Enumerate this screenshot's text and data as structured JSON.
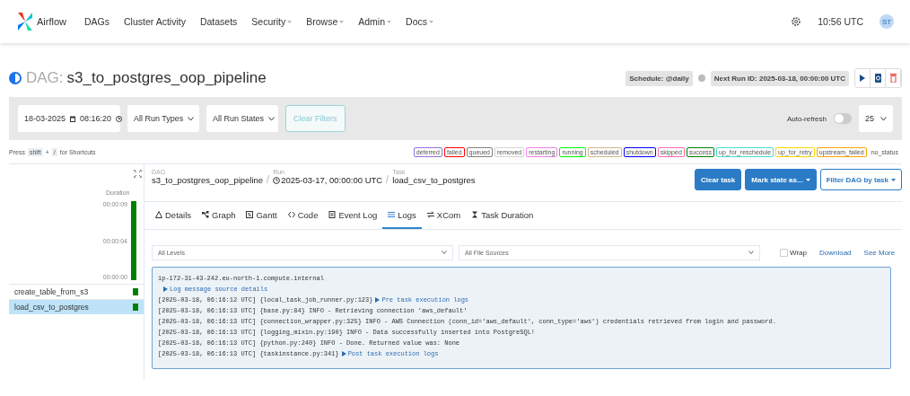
{
  "navbar": {
    "brand": "Airflow",
    "items": [
      {
        "label": "DAGs",
        "dropdown": false
      },
      {
        "label": "Cluster Activity",
        "dropdown": false
      },
      {
        "label": "Datasets",
        "dropdown": false
      },
      {
        "label": "Security",
        "dropdown": true
      },
      {
        "label": "Browse",
        "dropdown": true
      },
      {
        "label": "Admin",
        "dropdown": true
      },
      {
        "label": "Docs",
        "dropdown": true
      }
    ],
    "time": "10:56 UTC",
    "avatar": "ST"
  },
  "dag_header": {
    "paused_toggle": {
      "on": true
    },
    "prefix": "DAG:",
    "name": "s3_to_postgres_oop_pipeline",
    "schedule": "Schedule: @daily",
    "next_run": "Next Run ID: 2025-03-18, 00:00:00 UTC"
  },
  "filters": {
    "date": "18-03-2025",
    "time": "08:16:20",
    "run_types": "All Run Types",
    "run_states": "All Run States",
    "clear": "Clear Filters",
    "auto_refresh": {
      "label": "Auto-refresh",
      "on": false
    },
    "count": "25"
  },
  "shortcuts": {
    "press": "Press",
    "key1": "shift",
    "plus": "+",
    "key2": "/",
    "suffix": "for Shortcuts"
  },
  "legend": [
    {
      "label": "deferred",
      "color": "#9370db"
    },
    {
      "label": "failed",
      "color": "#ff0000"
    },
    {
      "label": "queued",
      "color": "#808080"
    },
    {
      "label": "removed",
      "color": "#d3d3d3"
    },
    {
      "label": "restarting",
      "color": "#ee82ee"
    },
    {
      "label": "running",
      "color": "#00ff00"
    },
    {
      "label": "scheduled",
      "color": "#d2b48c"
    },
    {
      "label": "shutdown",
      "color": "#0000ff"
    },
    {
      "label": "skipped",
      "color": "#ff69b4"
    },
    {
      "label": "success",
      "color": "#008000"
    },
    {
      "label": "up_for_reschedule",
      "color": "#40e0d0"
    },
    {
      "label": "up_for_retry",
      "color": "#ffd700"
    },
    {
      "label": "upstream_failed",
      "color": "#ffa500"
    },
    {
      "label": "no_status"
    }
  ],
  "grid": {
    "duration_label": "Duration",
    "ticks": [
      "00:00:09",
      "00:00:04",
      "00:00:00"
    ],
    "runs": [
      {
        "level": 1.0,
        "color": "#008000"
      }
    ],
    "tasks": [
      {
        "name": "create_table_from_s3",
        "selected": false,
        "color": "#008000"
      },
      {
        "name": "load_csv_to_postgres",
        "selected": true,
        "color": "#008000"
      }
    ]
  },
  "breadcrumb": [
    {
      "caption": "DAG",
      "value": "s3_to_postgres_oop_pipeline",
      "kind": "plain"
    },
    {
      "caption": "Run",
      "value": "2025-03-17, 00:00:00 UTC",
      "kind": "run"
    },
    {
      "caption": "Task",
      "value": "load_csv_to_postgres",
      "kind": "plain"
    }
  ],
  "actions": {
    "clear_task": "Clear task",
    "mark_state": "Mark state as...",
    "filter_dag": "Filter DAG by task"
  },
  "tabs": [
    {
      "label": "Details",
      "selected": false
    },
    {
      "label": "Graph",
      "selected": false
    },
    {
      "label": "Gantt",
      "selected": false
    },
    {
      "label": "Code",
      "selected": false
    },
    {
      "label": "Event Log",
      "selected": false
    },
    {
      "label": "Logs",
      "selected": true
    },
    {
      "label": "XCom",
      "selected": false
    },
    {
      "label": "Task Duration",
      "selected": false
    }
  ],
  "logs": {
    "level_select": "All Levels",
    "source_select": "All File Sources",
    "wrap": {
      "label": "Wrap",
      "checked": false
    },
    "download": "Download",
    "see_more": "See More",
    "lines": [
      {
        "text": "ip-172-31-43-242.eu-north-1.compute.internal"
      },
      {
        "link": "Log message source details"
      },
      {
        "text": "[2025-03-18, 06:16:12 UTC] {local_task_job_runner.py:123}",
        "link": "Pre task execution logs"
      },
      {
        "text": "[2025-03-18, 06:16:13 UTC] {base.py:84} INFO - Retrieving connection 'aws_default'"
      },
      {
        "text": "[2025-03-18, 06:16:13 UTC] {connection_wrapper.py:325} INFO - AWS Connection (conn_id='aws_default', conn_type='aws') credentials retrieved from login and password."
      },
      {
        "text": "[2025-03-18, 06:16:13 UTC] {logging_mixin.py:190} INFO - Data successfully inserted into PostgreSQL!"
      },
      {
        "text": "[2025-03-18, 06:16:13 UTC] {python.py:240} INFO - Done. Returned value was: None"
      },
      {
        "text": "[2025-03-18, 06:16:13 UTC] {taskinstance.py:341}",
        "link": "Post task execution logs"
      }
    ]
  }
}
